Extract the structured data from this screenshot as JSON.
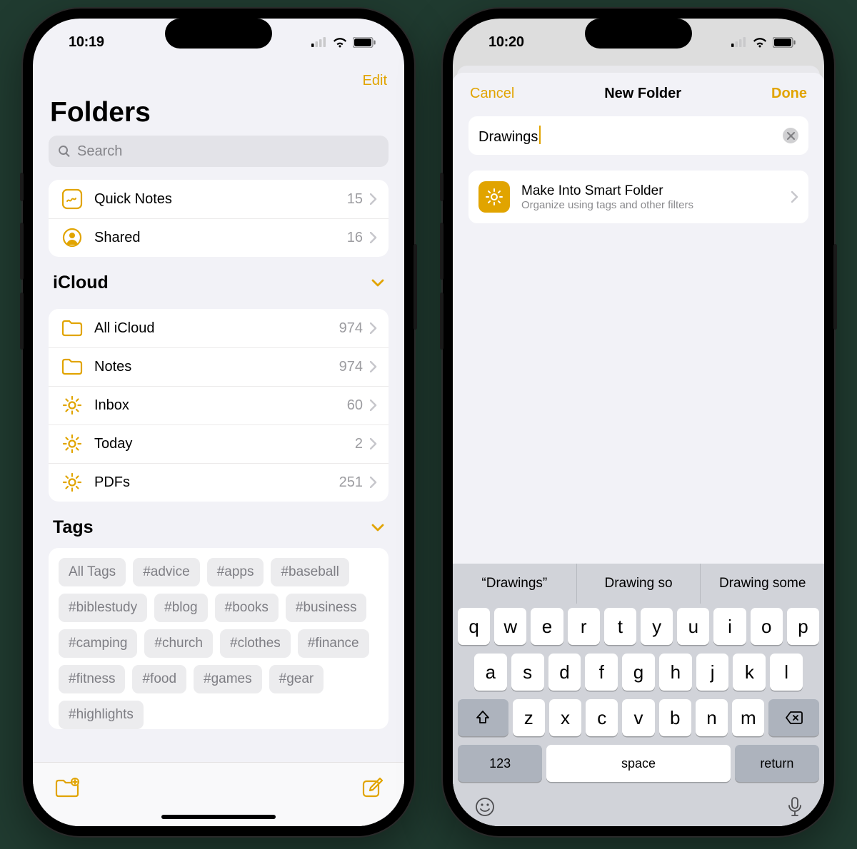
{
  "left": {
    "status": {
      "time": "10:19"
    },
    "nav": {
      "edit": "Edit"
    },
    "title": "Folders",
    "search_placeholder": "Search",
    "quick": [
      {
        "label": "Quick Notes",
        "count": "15"
      },
      {
        "label": "Shared",
        "count": "16"
      }
    ],
    "section_icloud": {
      "title": "iCloud"
    },
    "icloud": [
      {
        "label": "All iCloud",
        "count": "974",
        "icon": "folder"
      },
      {
        "label": "Notes",
        "count": "974",
        "icon": "folder"
      },
      {
        "label": "Inbox",
        "count": "60",
        "icon": "gear"
      },
      {
        "label": "Today",
        "count": "2",
        "icon": "gear"
      },
      {
        "label": "PDFs",
        "count": "251",
        "icon": "gear"
      }
    ],
    "section_tags": {
      "title": "Tags"
    },
    "tags": [
      "All Tags",
      "#advice",
      "#apps",
      "#baseball",
      "#biblestudy",
      "#blog",
      "#books",
      "#business",
      "#camping",
      "#church",
      "#clothes",
      "#finance",
      "#fitness",
      "#food",
      "#games",
      "#gear",
      "#highlights"
    ]
  },
  "right": {
    "status": {
      "time": "10:20"
    },
    "nav": {
      "cancel": "Cancel",
      "title": "New Folder",
      "done": "Done"
    },
    "input_value": "Drawings",
    "smart": {
      "title": "Make Into Smart Folder",
      "sub": "Organize using tags and other filters"
    },
    "predict": [
      "“Drawings”",
      "Drawing so",
      "Drawing some"
    ],
    "keys": {
      "r1": [
        "q",
        "w",
        "e",
        "r",
        "t",
        "y",
        "u",
        "i",
        "o",
        "p"
      ],
      "r2": [
        "a",
        "s",
        "d",
        "f",
        "g",
        "h",
        "j",
        "k",
        "l"
      ],
      "r3": [
        "z",
        "x",
        "c",
        "v",
        "b",
        "n",
        "m"
      ],
      "num": "123",
      "space": "space",
      "ret": "return"
    }
  }
}
